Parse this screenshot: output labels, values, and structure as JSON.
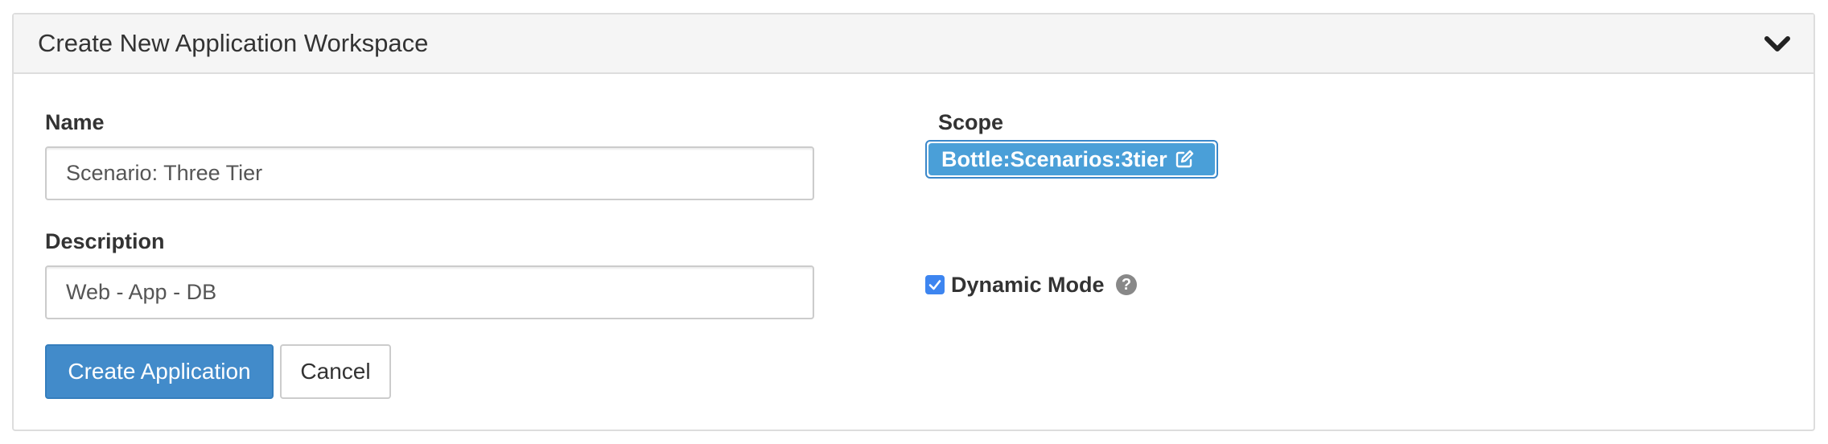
{
  "panel": {
    "title": "Create New Application Workspace",
    "collapse_icon": "chevron-down-icon"
  },
  "form": {
    "name_label": "Name",
    "name_value": "Scenario: Three Tier",
    "description_label": "Description",
    "description_value": "Web - App - DB",
    "scope_label": "Scope",
    "scope_value": "Bottle:Scenarios:3tier",
    "scope_icon": "edit-icon",
    "dynamic_mode_label": "Dynamic Mode",
    "dynamic_mode_checked": true,
    "help_icon": "question-circle-icon"
  },
  "actions": {
    "create_label": "Create Application",
    "cancel_label": "Cancel"
  },
  "colors": {
    "primary": "#428bca",
    "scope_badge": "#4a9fd8",
    "checkbox": "#3d85f0",
    "heading_bg": "#f5f5f5"
  }
}
